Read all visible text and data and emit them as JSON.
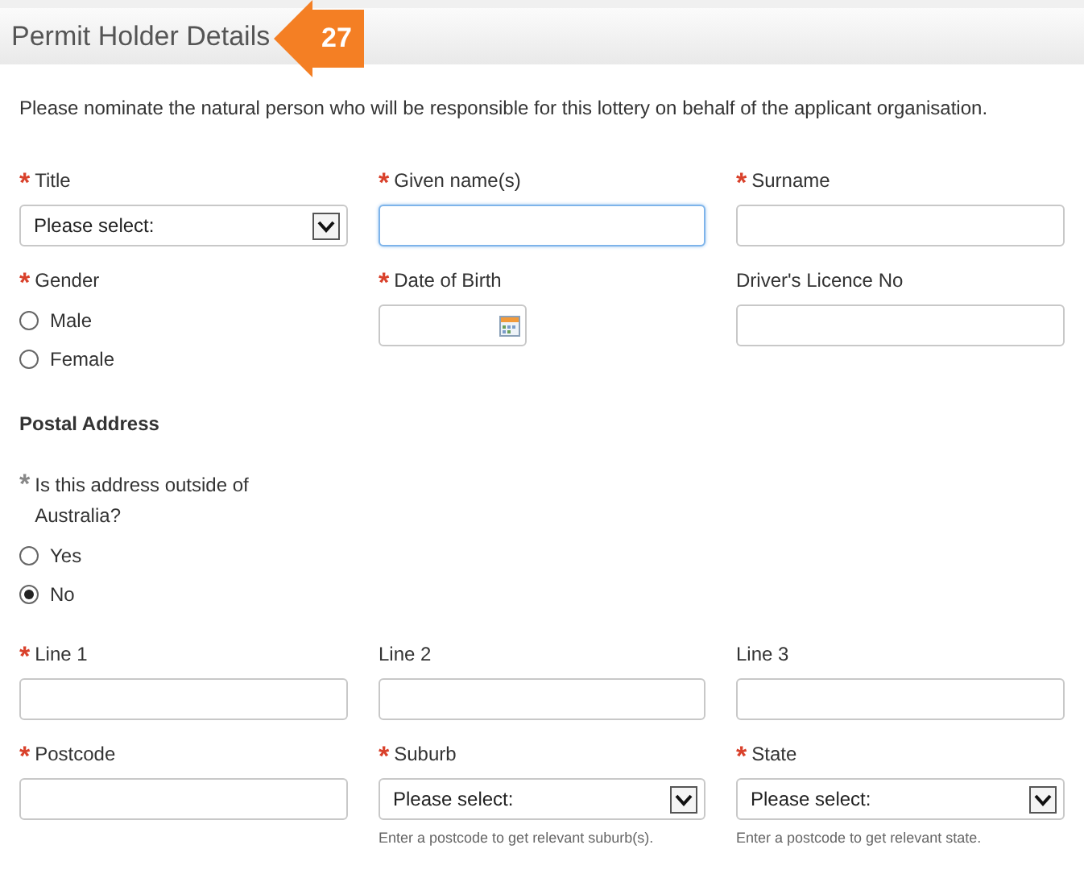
{
  "header": {
    "title": "Permit Holder Details",
    "callout": "27"
  },
  "intro": "Please nominate the natural person who will be responsible for this lottery on behalf of the applicant organisation.",
  "personal_fields": [
    {
      "kind": "select",
      "label": "Title",
      "required": "*",
      "value": "Please select:",
      "focused": false
    },
    {
      "kind": "text",
      "label": "Given name(s)",
      "required": "*",
      "focused": true
    },
    {
      "kind": "text",
      "label": "Surname",
      "required": "*",
      "focused": false
    },
    {
      "kind": "radio",
      "label": "Gender",
      "required": "*",
      "options": [
        {
          "label": "Male",
          "selected": false
        },
        {
          "label": "Female",
          "selected": false
        }
      ]
    },
    {
      "kind": "date",
      "label": "Date of Birth",
      "required": "*",
      "focused": false
    },
    {
      "kind": "text",
      "label": "Driver's Licence No",
      "focused": false
    }
  ],
  "postal_address": {
    "heading": "Postal Address",
    "question": {
      "label": "Is this address outside of Australia?",
      "required": "*",
      "muted": true,
      "options": [
        {
          "label": "Yes",
          "selected": false
        },
        {
          "label": "No",
          "selected": true
        }
      ]
    },
    "fields": [
      {
        "kind": "text",
        "label": "Line 1",
        "required": "*",
        "focused": false
      },
      {
        "kind": "text",
        "label": "Line 2",
        "focused": false
      },
      {
        "kind": "text",
        "label": "Line 3",
        "focused": false
      },
      {
        "kind": "text",
        "label": "Postcode",
        "required": "*",
        "focused": false
      },
      {
        "kind": "select",
        "label": "Suburb",
        "required": "*",
        "value": "Please select:",
        "focused": false,
        "hint": "Enter a postcode to get relevant suburb(s)."
      },
      {
        "kind": "select",
        "label": "State",
        "required": "*",
        "value": "Please select:",
        "focused": false,
        "hint": "Enter a postcode to get relevant state."
      }
    ]
  }
}
